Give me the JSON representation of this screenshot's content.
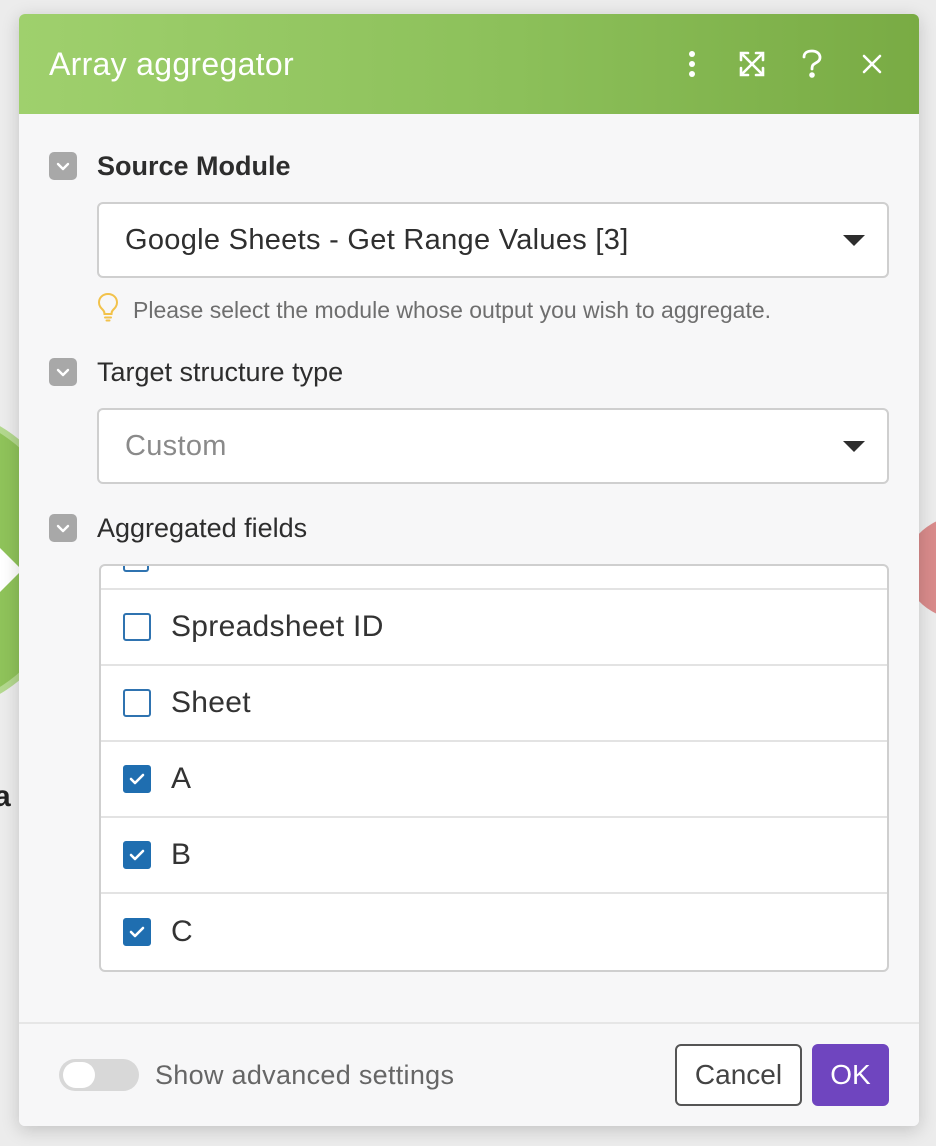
{
  "dialog": {
    "title": "Array aggregator",
    "header_icons": [
      "more-vertical-icon",
      "expand-icon",
      "help-icon",
      "close-icon"
    ]
  },
  "source_module": {
    "label": "Source Module",
    "value": "Google Sheets - Get Range Values [3]",
    "hint": "Please select the module whose output you wish to aggregate."
  },
  "target_structure": {
    "label": "Target structure type",
    "value": "Custom"
  },
  "aggregated_fields": {
    "label": "Aggregated fields",
    "items": [
      {
        "label": "Spreadsheet ID",
        "checked": false
      },
      {
        "label": "Sheet",
        "checked": false
      },
      {
        "label": "A",
        "checked": true
      },
      {
        "label": "B",
        "checked": true
      },
      {
        "label": "C",
        "checked": true
      }
    ]
  },
  "footer": {
    "advanced_label": "Show advanced settings",
    "advanced_enabled": false,
    "cancel_label": "Cancel",
    "ok_label": "OK"
  },
  "colors": {
    "header_green": "#8cc05a",
    "checkbox_blue": "#1f6eb0",
    "ok_purple": "#6f45bf",
    "hint_bulb": "#f2c24b"
  }
}
